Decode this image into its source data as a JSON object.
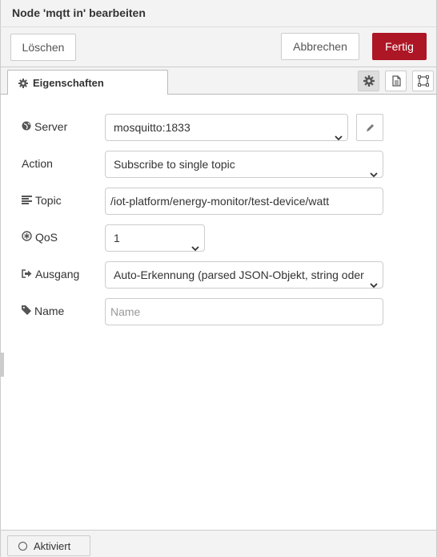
{
  "dialog": {
    "title": "Node 'mqtt in' bearbeiten"
  },
  "toolbar": {
    "delete_label": "Löschen",
    "cancel_label": "Abbrechen",
    "done_label": "Fertig",
    "accent": "#ad1625"
  },
  "tabs": {
    "properties_label": "Eigenschaften"
  },
  "form": {
    "server": {
      "label": "Server",
      "value": "mosquitto:1833"
    },
    "action": {
      "label": "Action",
      "value": "Subscribe to single topic"
    },
    "topic": {
      "label": "Topic",
      "value": "/iot-platform/energy-monitor/test-device/watt"
    },
    "qos": {
      "label": "QoS",
      "value": "1"
    },
    "output": {
      "label": "Ausgang",
      "value": "Auto-Erkennung (parsed JSON-Objekt, string oder"
    },
    "name": {
      "label": "Name",
      "value": "",
      "placeholder": "Name"
    }
  },
  "footer": {
    "enabled_label": "Aktiviert"
  },
  "icons": [
    "globe-icon",
    "topic-icon",
    "qos-icon",
    "output-icon",
    "tag-icon",
    "gear-icon",
    "pencil-icon",
    "document-icon",
    "frame-icon",
    "chevron-down-icon"
  ]
}
